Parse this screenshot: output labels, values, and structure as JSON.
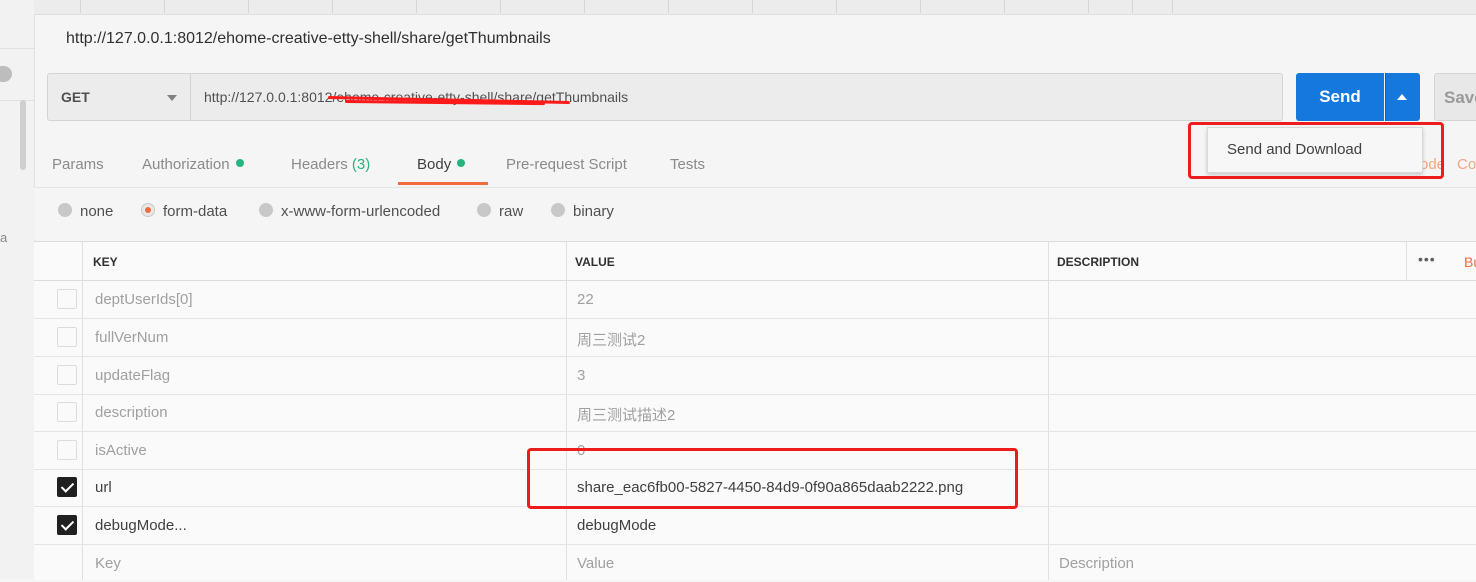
{
  "page_title": "http://127.0.0.1:8012/ehome-creative-etty-shell/share/getThumbnails",
  "sidebar": {
    "truncated_char": "a"
  },
  "request": {
    "method": "GET",
    "url": "http://127.0.0.1:8012/ehome-creative-etty-shell/share/getThumbnails",
    "send_label": "Send",
    "save_label": "Save",
    "send_menu": [
      "Send and Download"
    ]
  },
  "tabs": [
    {
      "label": "Params"
    },
    {
      "label": "Authorization",
      "indicator": true
    },
    {
      "label": "Headers",
      "count": "(3)"
    },
    {
      "label": "Body",
      "indicator": true,
      "active": true
    },
    {
      "label": "Pre-request Script"
    },
    {
      "label": "Tests"
    }
  ],
  "right_links": {
    "code_partial": "ode",
    "cookies_partial": "Co"
  },
  "body_types": [
    {
      "label": "none",
      "selected": false
    },
    {
      "label": "form-data",
      "selected": true
    },
    {
      "label": "x-www-form-urlencoded",
      "selected": false
    },
    {
      "label": "raw",
      "selected": false
    },
    {
      "label": "binary",
      "selected": false
    }
  ],
  "table": {
    "headers": {
      "key": "KEY",
      "value": "VALUE",
      "description": "DESCRIPTION",
      "bulk_partial": "Bu"
    },
    "rows": [
      {
        "key": "deptUserIds[0]",
        "value": "22",
        "checked": false
      },
      {
        "key": "fullVerNum",
        "value": "周三测试2",
        "checked": false
      },
      {
        "key": "updateFlag",
        "value": "3",
        "checked": false
      },
      {
        "key": "description",
        "value": "周三测试描述2",
        "checked": false
      },
      {
        "key": "isActive",
        "value": "0",
        "checked": false
      },
      {
        "key": "url",
        "value": "share_eac6fb00-5827-4450-84d9-0f90a865daab2222.png",
        "checked": true
      },
      {
        "key": "debugMode...",
        "value": "debugMode",
        "checked": true
      }
    ],
    "placeholders": {
      "key": "Key",
      "value": "Value",
      "description": "Description"
    }
  },
  "colors": {
    "primary": "#1478dc",
    "accent": "#f26b3a",
    "indicator": "#26b47f",
    "annotation": "#ee1c1c"
  }
}
